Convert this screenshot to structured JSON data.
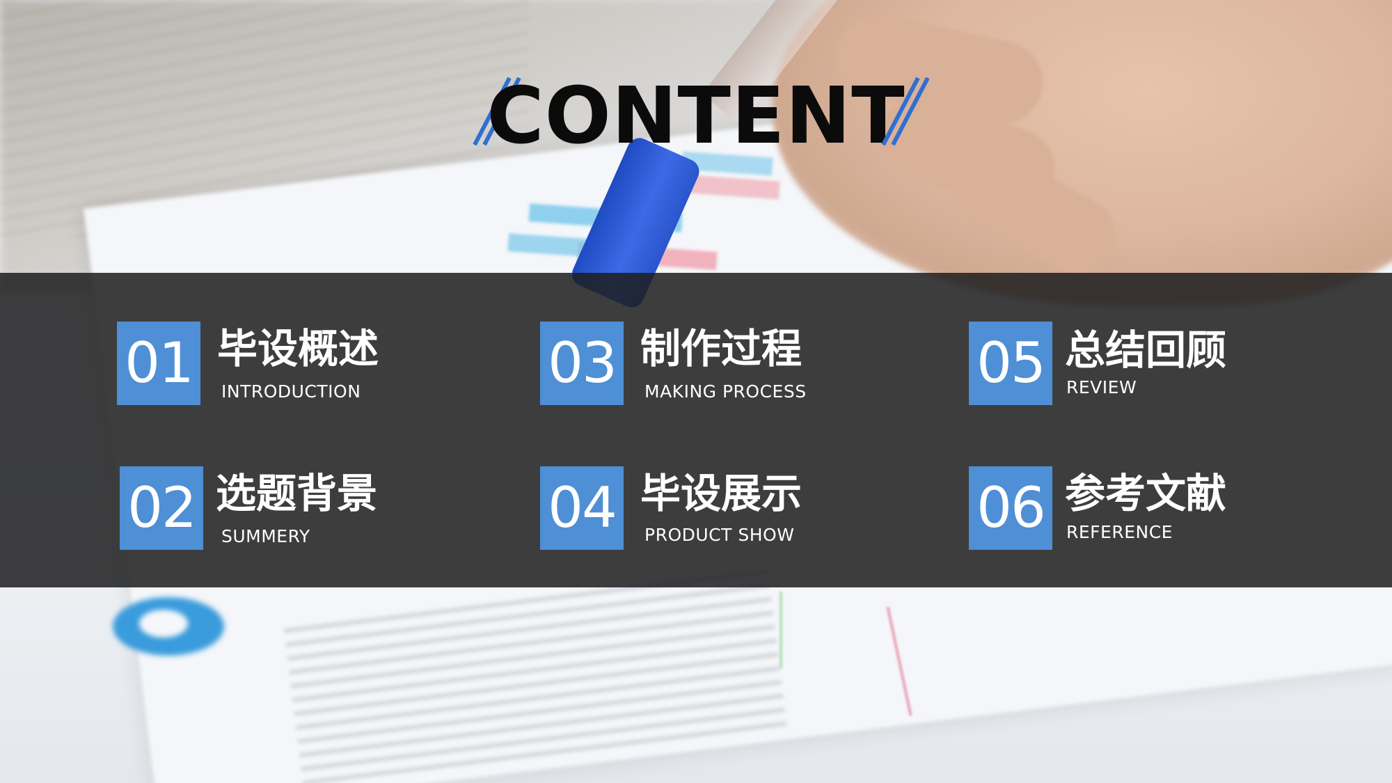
{
  "title": "CONTENT",
  "colors": {
    "accent": "#4e8fd6",
    "band": "#1e1e20",
    "title_text": "#0b0b0b",
    "item_text": "#ffffff"
  },
  "items": [
    {
      "number": "01",
      "title_cn": "毕设概述",
      "title_en": "INTRODUCTION"
    },
    {
      "number": "02",
      "title_cn": "选题背景",
      "title_en": "SUMMERY"
    },
    {
      "number": "03",
      "title_cn": "制作过程",
      "title_en": "MAKING PROCESS"
    },
    {
      "number": "04",
      "title_cn": "毕设展示",
      "title_en": "PRODUCT SHOW"
    },
    {
      "number": "05",
      "title_cn": "总结回顾",
      "title_en": "REVIEW"
    },
    {
      "number": "06",
      "title_cn": "参考文献",
      "title_en": "REFERENCE"
    }
  ]
}
